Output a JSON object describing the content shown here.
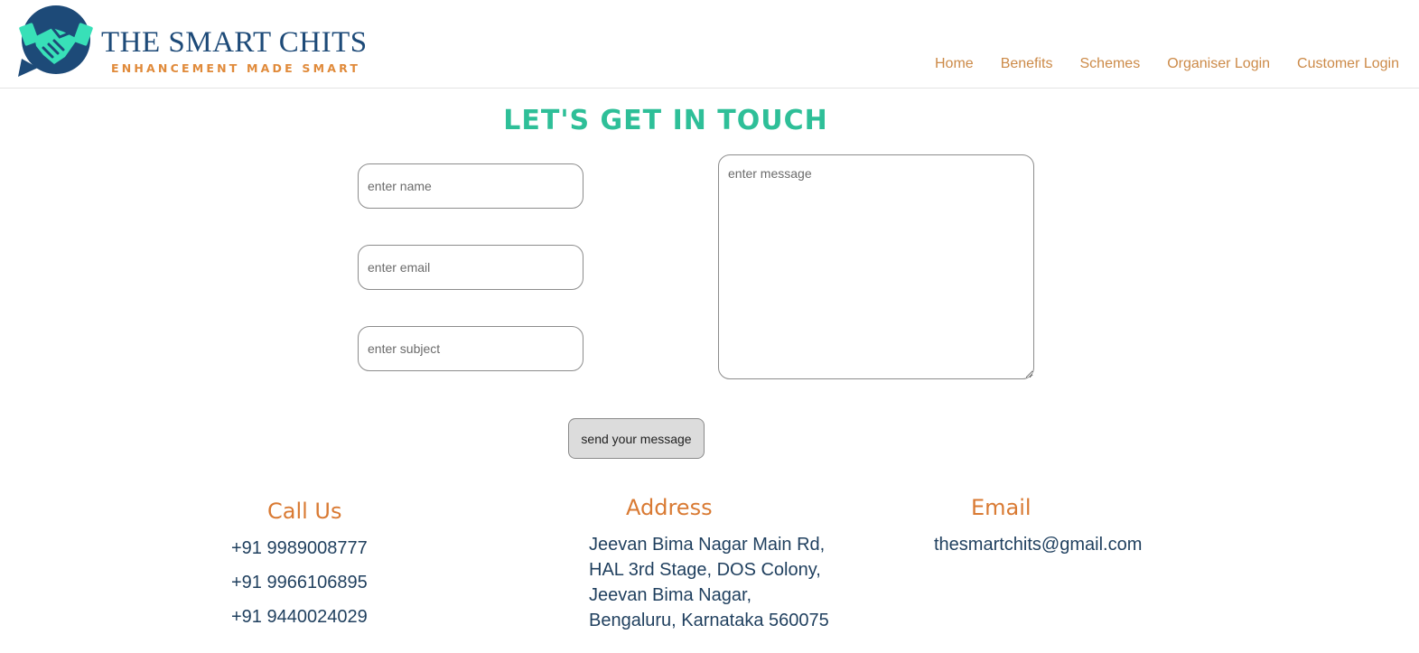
{
  "brand": {
    "title": "THE SMART CHITS",
    "tagline": "ENHANCEMENT MADE SMART",
    "colors": {
      "navy": "#1d4a78",
      "teal": "#38e0b8",
      "orange": "#e08a3a"
    }
  },
  "nav": {
    "items": [
      {
        "label": "Home"
      },
      {
        "label": "Benefits"
      },
      {
        "label": "Schemes"
      },
      {
        "label": "Organiser Login"
      },
      {
        "label": "Customer Login"
      }
    ]
  },
  "contact": {
    "title": "LET'S GET IN TOUCH",
    "name_placeholder": "enter name",
    "email_placeholder": "enter email",
    "subject_placeholder": "enter subject",
    "message_placeholder": "enter message",
    "send_label": "send your message"
  },
  "footer": {
    "call": {
      "heading": "Call Us",
      "phones": [
        "+91 9989008777",
        "+91 9966106895",
        "+91 9440024029"
      ]
    },
    "address": {
      "heading": "Address",
      "lines": [
        "Jeevan Bima Nagar Main Rd,",
        "HAL 3rd Stage, DOS Colony,",
        "Jeevan Bima Nagar,",
        "Bengaluru, Karnataka 560075"
      ]
    },
    "email": {
      "heading": "Email",
      "value": "thesmartchits@gmail.com"
    }
  },
  "colors": {
    "heading_teal": "#2ebf98",
    "nav_orange": "#cc8a48",
    "footer_heading": "#d97a33",
    "footer_text": "#1f3f5e"
  }
}
